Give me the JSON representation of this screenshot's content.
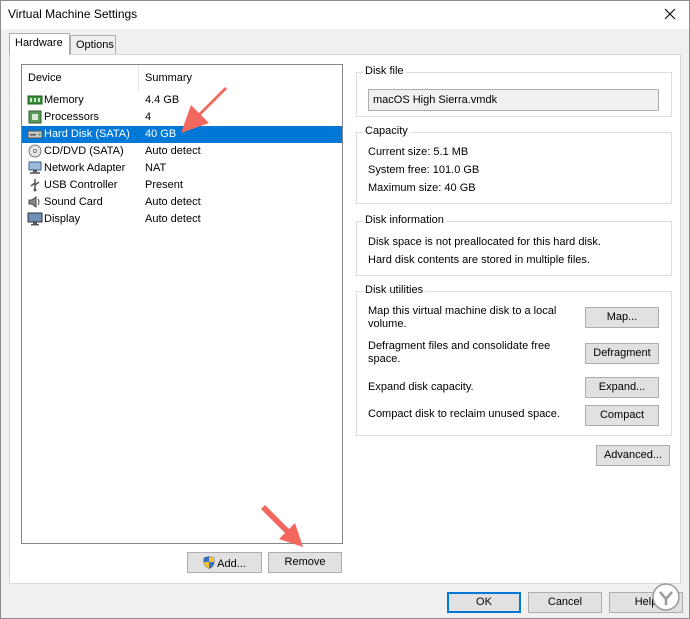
{
  "window": {
    "title": "Virtual Machine Settings"
  },
  "tabs": [
    {
      "label": "Hardware",
      "active": true
    },
    {
      "label": "Options",
      "active": false
    }
  ],
  "device_list": {
    "headers": {
      "device": "Device",
      "summary": "Summary"
    },
    "rows": [
      {
        "name": "Memory",
        "summary": "4.4 GB",
        "icon": "memory-icon",
        "selected": false
      },
      {
        "name": "Processors",
        "summary": "4",
        "icon": "processor-icon",
        "selected": false
      },
      {
        "name": "Hard Disk (SATA)",
        "summary": "40 GB",
        "icon": "hard-disk-icon",
        "selected": true
      },
      {
        "name": "CD/DVD (SATA)",
        "summary": "Auto detect",
        "icon": "cd-dvd-icon",
        "selected": false
      },
      {
        "name": "Network Adapter",
        "summary": "NAT",
        "icon": "network-adapter-icon",
        "selected": false
      },
      {
        "name": "USB Controller",
        "summary": "Present",
        "icon": "usb-icon",
        "selected": false
      },
      {
        "name": "Sound Card",
        "summary": "Auto detect",
        "icon": "speaker-icon",
        "selected": false
      },
      {
        "name": "Display",
        "summary": "Auto detect",
        "icon": "monitor-icon",
        "selected": false
      }
    ]
  },
  "list_buttons": {
    "add": "Add...",
    "remove": "Remove"
  },
  "disk_file": {
    "title": "Disk file",
    "value": "macOS High Sierra.vmdk"
  },
  "capacity": {
    "title": "Capacity",
    "current": "Current size:  5.1 MB",
    "system_free": "System free:  101.0 GB",
    "maximum": "Maximum size:  40 GB"
  },
  "disk_information": {
    "title": "Disk information",
    "line1": "Disk space is not preallocated for this hard disk.",
    "line2": "Hard disk contents are stored in multiple files."
  },
  "disk_utilities": {
    "title": "Disk utilities",
    "map_text": "Map this virtual machine disk to a local volume.",
    "map_button": "Map...",
    "defrag_text": "Defragment files and consolidate free space.",
    "defrag_button": "Defragment",
    "expand_text": "Expand disk capacity.",
    "expand_button": "Expand...",
    "compact_text": "Compact disk to reclaim unused space.",
    "compact_button": "Compact"
  },
  "advanced_button": "Advanced...",
  "footer": {
    "ok": "OK",
    "cancel": "Cancel",
    "help": "Help"
  },
  "colors": {
    "selection": "#0078d7",
    "arrow": "#f2685f",
    "button_face": "#e1e1e1"
  }
}
